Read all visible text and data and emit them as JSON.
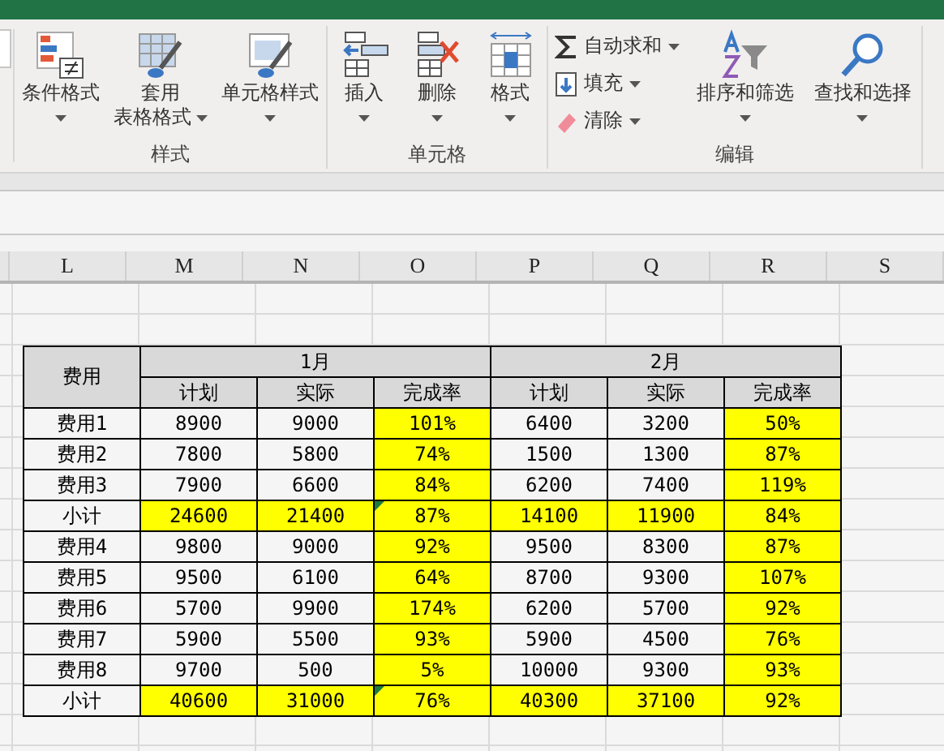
{
  "ribbon": {
    "groups": [
      {
        "label": "样式",
        "buttons": [
          {
            "lines": [
              "条件格式"
            ],
            "dropdown": true
          },
          {
            "lines": [
              "套用",
              "表格格式"
            ],
            "dropdown": true
          },
          {
            "lines": [
              "单元格样式"
            ],
            "dropdown": true
          }
        ]
      },
      {
        "label": "单元格",
        "buttons": [
          {
            "lines": [
              "插入"
            ],
            "dropdown": true
          },
          {
            "lines": [
              "删除"
            ],
            "dropdown": true
          },
          {
            "lines": [
              "格式"
            ],
            "dropdown": true
          }
        ]
      },
      {
        "label": "编辑",
        "small": [
          {
            "label": "自动求和",
            "dropdown": true
          },
          {
            "label": "填充",
            "dropdown": true
          },
          {
            "label": "清除",
            "dropdown": true
          }
        ],
        "buttons": [
          {
            "lines": [
              "排序和筛选"
            ],
            "dropdown": true
          },
          {
            "lines": [
              "查找和选择"
            ],
            "dropdown": true
          }
        ]
      }
    ]
  },
  "sheet": {
    "columns": [
      "L",
      "M",
      "N",
      "O",
      "P",
      "Q",
      "R",
      "S"
    ],
    "table": {
      "corner": "费用",
      "months": [
        "1月",
        "2月"
      ],
      "subheads": [
        "计划",
        "实际",
        "完成率",
        "计划",
        "实际",
        "完成率"
      ],
      "rows": [
        {
          "label": "费用1",
          "cells": [
            {
              "text": "8900",
              "highlighted": false
            },
            {
              "text": "9000",
              "highlighted": false
            },
            {
              "text": "101%",
              "highlighted": true
            },
            {
              "text": "6400",
              "highlighted": false
            },
            {
              "text": "3200",
              "highlighted": false
            },
            {
              "text": "50%",
              "highlighted": true
            }
          ]
        },
        {
          "label": "费用2",
          "cells": [
            {
              "text": "7800",
              "highlighted": false
            },
            {
              "text": "5800",
              "highlighted": false
            },
            {
              "text": "74%",
              "highlighted": true
            },
            {
              "text": "1500",
              "highlighted": false
            },
            {
              "text": "1300",
              "highlighted": false
            },
            {
              "text": "87%",
              "highlighted": true
            }
          ]
        },
        {
          "label": "费用3",
          "cells": [
            {
              "text": "7900",
              "highlighted": false
            },
            {
              "text": "6600",
              "highlighted": false
            },
            {
              "text": "84%",
              "highlighted": true
            },
            {
              "text": "6200",
              "highlighted": false
            },
            {
              "text": "7400",
              "highlighted": false
            },
            {
              "text": "119%",
              "highlighted": true
            }
          ]
        },
        {
          "label": "小计",
          "cells": [
            {
              "text": "24600",
              "highlighted": true
            },
            {
              "text": "21400",
              "highlighted": true
            },
            {
              "text": "87%",
              "highlighted": true,
              "flagged": true
            },
            {
              "text": "14100",
              "highlighted": true
            },
            {
              "text": "11900",
              "highlighted": true
            },
            {
              "text": "84%",
              "highlighted": true
            }
          ]
        },
        {
          "label": "费用4",
          "cells": [
            {
              "text": "9800",
              "highlighted": false
            },
            {
              "text": "9000",
              "highlighted": false
            },
            {
              "text": "92%",
              "highlighted": true
            },
            {
              "text": "9500",
              "highlighted": false
            },
            {
              "text": "8300",
              "highlighted": false
            },
            {
              "text": "87%",
              "highlighted": true
            }
          ]
        },
        {
          "label": "费用5",
          "cells": [
            {
              "text": "9500",
              "highlighted": false
            },
            {
              "text": "6100",
              "highlighted": false
            },
            {
              "text": "64%",
              "highlighted": true
            },
            {
              "text": "8700",
              "highlighted": false
            },
            {
              "text": "9300",
              "highlighted": false
            },
            {
              "text": "107%",
              "highlighted": true
            }
          ]
        },
        {
          "label": "费用6",
          "cells": [
            {
              "text": "5700",
              "highlighted": false
            },
            {
              "text": "9900",
              "highlighted": false
            },
            {
              "text": "174%",
              "highlighted": true
            },
            {
              "text": "6200",
              "highlighted": false
            },
            {
              "text": "5700",
              "highlighted": false
            },
            {
              "text": "92%",
              "highlighted": true
            }
          ]
        },
        {
          "label": "费用7",
          "cells": [
            {
              "text": "5900",
              "highlighted": false
            },
            {
              "text": "5500",
              "highlighted": false
            },
            {
              "text": "93%",
              "highlighted": true
            },
            {
              "text": "5900",
              "highlighted": false
            },
            {
              "text": "4500",
              "highlighted": false
            },
            {
              "text": "76%",
              "highlighted": true
            }
          ]
        },
        {
          "label": "费用8",
          "cells": [
            {
              "text": "9700",
              "highlighted": false
            },
            {
              "text": "500",
              "highlighted": false
            },
            {
              "text": "5%",
              "highlighted": true
            },
            {
              "text": "10000",
              "highlighted": false
            },
            {
              "text": "9300",
              "highlighted": false
            },
            {
              "text": "93%",
              "highlighted": true
            }
          ]
        },
        {
          "label": "小计",
          "cells": [
            {
              "text": "40600",
              "highlighted": true
            },
            {
              "text": "31000",
              "highlighted": true
            },
            {
              "text": "76%",
              "highlighted": true,
              "flagged": true
            },
            {
              "text": "40300",
              "highlighted": true
            },
            {
              "text": "37100",
              "highlighted": true
            },
            {
              "text": "92%",
              "highlighted": true
            }
          ]
        }
      ]
    }
  }
}
